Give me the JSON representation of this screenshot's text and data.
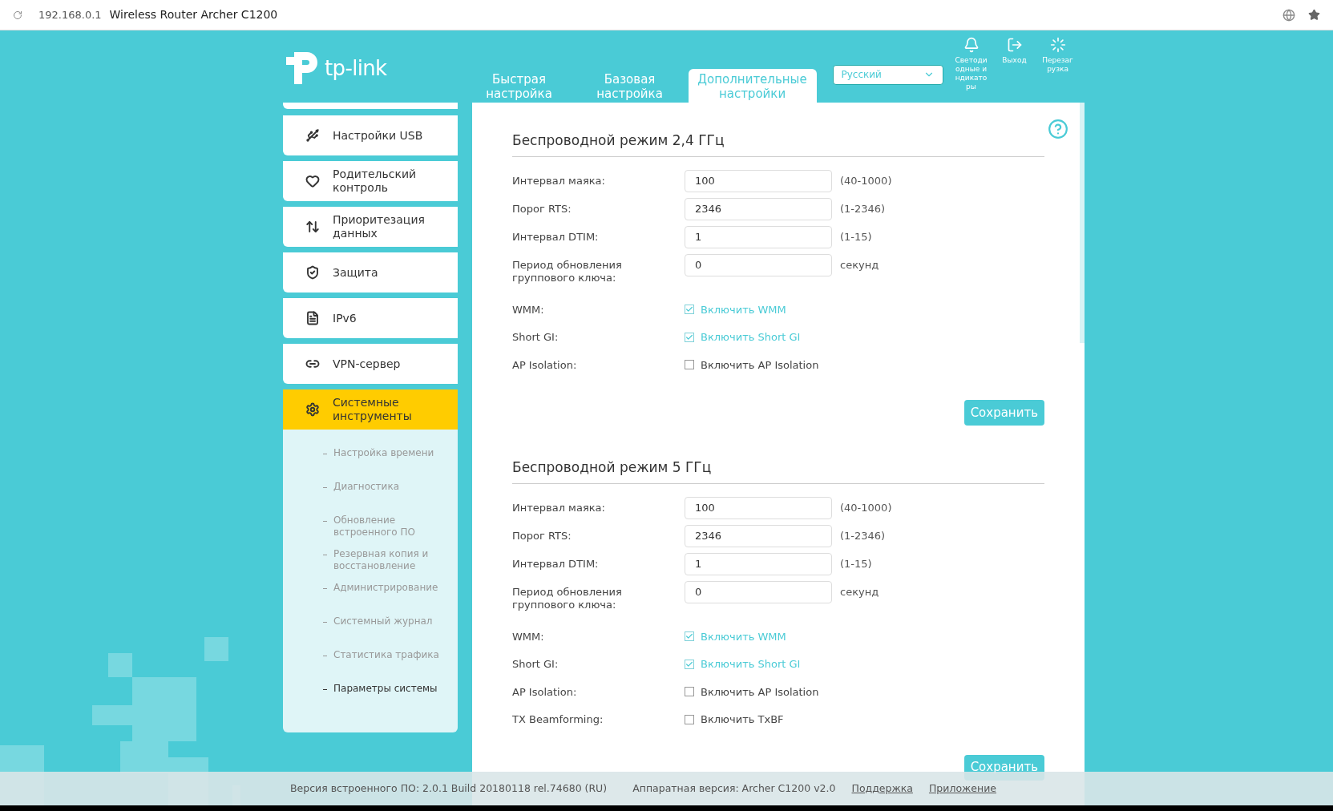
{
  "browser": {
    "url": "192.168.0.1",
    "title": "Wireless Router Archer C1200"
  },
  "header": {
    "logo": "tp-link",
    "tabs": [
      {
        "label": "Быстрая настройка",
        "selected": false
      },
      {
        "label": "Базовая настройка",
        "selected": false
      },
      {
        "label": "Дополнительные настройки",
        "selected": true
      }
    ],
    "language": "Русский",
    "actions": [
      {
        "kind": "led",
        "label": "Светодиодные индикаторы"
      },
      {
        "kind": "logout",
        "label": "Выход"
      },
      {
        "kind": "reboot",
        "label": "Перезагрузка"
      }
    ]
  },
  "sidebar": {
    "items": [
      {
        "kind": "usb",
        "label": "Настройки USB",
        "selected": false
      },
      {
        "kind": "parental",
        "label": "Родительский контроль",
        "selected": false
      },
      {
        "kind": "qos",
        "label": "Приоритезация данных",
        "selected": false
      },
      {
        "kind": "security",
        "label": "Защита",
        "selected": false
      },
      {
        "kind": "ipv6",
        "label": "IPv6",
        "selected": false
      },
      {
        "kind": "vpn",
        "label": "VPN-сервер",
        "selected": false
      },
      {
        "kind": "tools",
        "label": "Системные инструменты",
        "selected": true
      }
    ],
    "subitems": [
      {
        "label": "Настройка времени",
        "selected": false
      },
      {
        "label": "Диагностика",
        "selected": false
      },
      {
        "label": "Обновление встроенного ПО",
        "selected": false
      },
      {
        "label": "Резервная копия и восстановление",
        "selected": false
      },
      {
        "label": "Администрирование",
        "selected": false
      },
      {
        "label": "Системный журнал",
        "selected": false
      },
      {
        "label": "Статистика трафика",
        "selected": false
      },
      {
        "label": "Параметры системы",
        "selected": true
      }
    ]
  },
  "sections": [
    {
      "title": "Беспроводной режим 2,4 ГГц",
      "fields": [
        {
          "label": "Интервал маяка:",
          "value": "100",
          "hint": "(40-1000)"
        },
        {
          "label": "Порог RTS:",
          "value": "2346",
          "hint": "(1-2346)"
        },
        {
          "label": "Интервал DTIM:",
          "value": "1",
          "hint": "(1-15)"
        },
        {
          "label": "Период обновления группового ключа:",
          "value": "0",
          "hint": "секунд"
        }
      ],
      "options": [
        {
          "label": "WMM:",
          "text": "Включить WMM",
          "checked": true
        },
        {
          "label": "Short GI:",
          "text": "Включить Short GI",
          "checked": true
        },
        {
          "label": "AP Isolation:",
          "text": "Включить AP Isolation",
          "checked": false
        }
      ],
      "save": "Сохранить"
    },
    {
      "title": "Беспроводной режим 5 ГГц",
      "fields": [
        {
          "label": "Интервал маяка:",
          "value": "100",
          "hint": "(40-1000)"
        },
        {
          "label": "Порог RTS:",
          "value": "2346",
          "hint": "(1-2346)"
        },
        {
          "label": "Интервал DTIM:",
          "value": "1",
          "hint": "(1-15)"
        },
        {
          "label": "Период обновления группового ключа:",
          "value": "0",
          "hint": "секунд"
        }
      ],
      "options": [
        {
          "label": "WMM:",
          "text": "Включить WMM",
          "checked": true
        },
        {
          "label": "Short GI:",
          "text": "Включить Short GI",
          "checked": true
        },
        {
          "label": "AP Isolation:",
          "text": "Включить AP Isolation",
          "checked": false
        },
        {
          "label": "TX Beamforming:",
          "text": "Включить TxBF",
          "checked": false
        }
      ],
      "save": "Сохранить"
    }
  ],
  "footer": {
    "firmware": "Версия встроенного ПО: 2.0.1 Build 20180118 rel.74680 (RU)",
    "hardware": "Аппаратная версия: Archer C1200 v2.0",
    "links": [
      "Поддержка",
      "Приложение"
    ]
  }
}
